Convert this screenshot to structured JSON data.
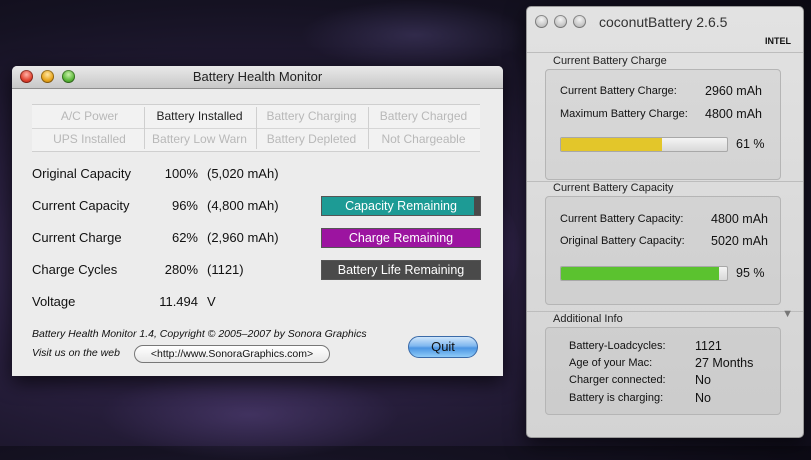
{
  "bhm": {
    "title": "Battery Health Monitor",
    "status_grid": [
      [
        "A/C Power",
        "Battery Installed",
        "Battery Charging",
        "Battery Charged"
      ],
      [
        "UPS Installed",
        "Battery Low Warn",
        "Battery Depleted",
        "Not Chargeable"
      ]
    ],
    "rows": [
      {
        "label": "Original Capacity",
        "pct": "100%",
        "val": "(5,020 mAh)"
      },
      {
        "label": "Current Capacity",
        "pct": "96%",
        "val": "(4,800 mAh)"
      },
      {
        "label": "Current Charge",
        "pct": "62%",
        "val": "(2,960 mAh)"
      },
      {
        "label": "Charge Cycles",
        "pct": "280%",
        "val": "(1121)"
      },
      {
        "label": "Voltage",
        "pct": "11.494",
        "val": "V"
      }
    ],
    "bars": [
      {
        "label": "Capacity Remaining",
        "fill_pct": 96,
        "color": "#1d9b95"
      },
      {
        "label": "Charge Remaining",
        "fill_pct": 100,
        "color": "#9c14a0"
      },
      {
        "label": "Battery Life Remaining",
        "fill_pct": 0,
        "color": "#4a4a4a"
      }
    ],
    "footer_line1": "Battery Health Monitor 1.4, Copyright © 2005–2007 by Sonora Graphics",
    "footer_line2": "Visit us on the web",
    "link_label": "<http://www.SonoraGraphics.com>",
    "quit_label": "Quit"
  },
  "cb": {
    "title": "coconutBattery 2.6.5",
    "intel": "INTEL",
    "charge_section": {
      "title": "Current Battery Charge",
      "label1": "Current Battery Charge:",
      "value1": "2960 mAh",
      "label2": "Maximum Battery Charge:",
      "value2": "4800 mAh",
      "percent": "61 %",
      "fill_pct": 61,
      "color": "#e3c62a"
    },
    "capacity_section": {
      "title": "Current Battery Capacity",
      "label1": "Current Battery Capacity:",
      "value1": "4800 mAh",
      "label2": "Original Battery Capacity:",
      "value2": "5020 mAh",
      "percent": "95 %",
      "fill_pct": 95,
      "color": "#5bc22f"
    },
    "additional": {
      "title": "Additional Info",
      "items": [
        {
          "label": "Battery-Loadcycles:",
          "value": "1121"
        },
        {
          "label": "Age of your Mac:",
          "value": "27 Months"
        },
        {
          "label": "Charger connected:",
          "value": "No"
        },
        {
          "label": "Battery is charging:",
          "value": "No"
        }
      ]
    }
  }
}
